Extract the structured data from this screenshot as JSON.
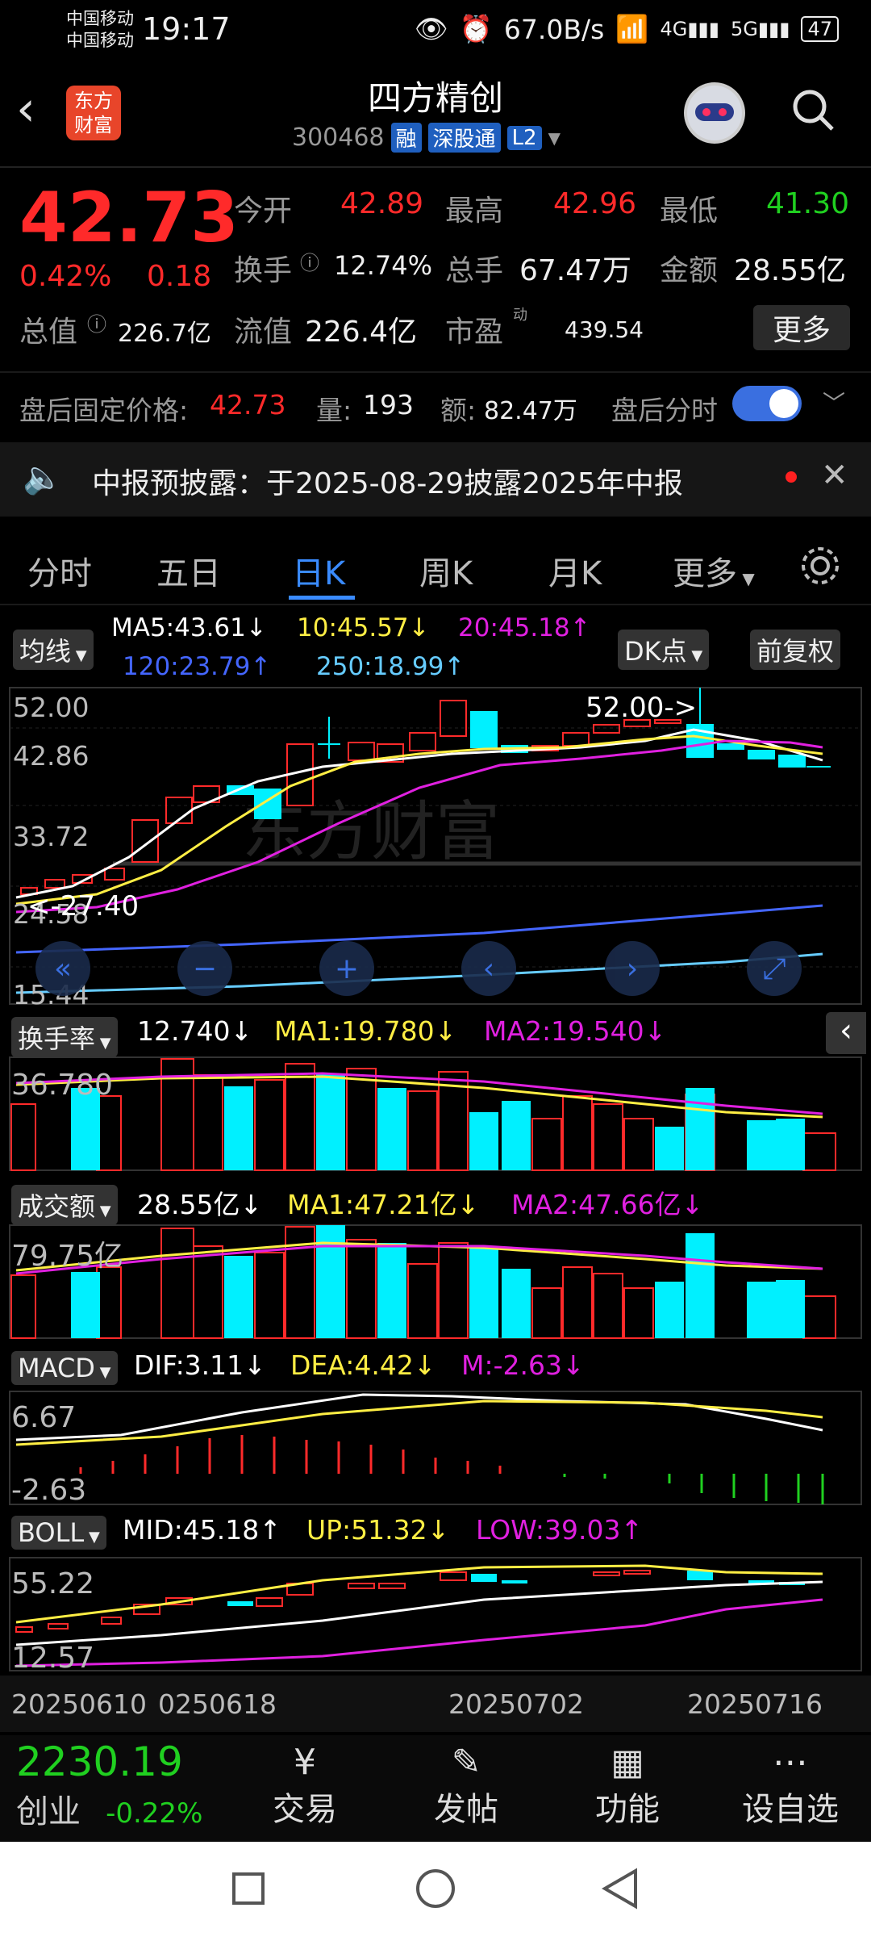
{
  "status": {
    "carrier1": "中国移动",
    "carrier2": "中国移动",
    "time": "19:17",
    "speed": "67.0B/s",
    "battery": "47"
  },
  "header": {
    "logo_line1": "东方",
    "logo_line2": "财富",
    "title": "四方精创",
    "code": "300468",
    "tag1": "融",
    "tag2": "深股通",
    "tag3": "L2"
  },
  "quote": {
    "price": "42.73",
    "pct": "0.42%",
    "change": "0.18",
    "open_label": "今开",
    "open": "42.89",
    "high_label": "最高",
    "high": "42.96",
    "low_label": "最低",
    "low": "41.30",
    "turnover_label": "换手",
    "turnover": "12.74%",
    "vol_label": "总手",
    "vol": "67.47万",
    "amount_label": "金额",
    "amount": "28.55亿",
    "mcap_label": "总值",
    "mcap": "226.7亿",
    "float_label": "流值",
    "float": "226.4亿",
    "pe_label": "市盈",
    "pe_sup": "动",
    "pe": "439.54",
    "more": "更多"
  },
  "afterhours": {
    "label": "盘后固定价格:",
    "price": "42.73",
    "vol_label": "量:",
    "vol": "193",
    "amt_label": "额:",
    "amt": "82.47万",
    "toggle_label": "盘后分时"
  },
  "notice": {
    "text": "中报预披露：于2025-08-29披露2025年中报"
  },
  "tabs": [
    "分时",
    "五日",
    "日K",
    "周K",
    "月K",
    "更多"
  ],
  "ma": {
    "btn": "均线",
    "ma5": "MA5:43.61↓",
    "ma10": "10:45.57↓",
    "ma20": "20:45.18↑",
    "ma120": "120:23.79↑",
    "ma250": "250:18.99↑",
    "dk": "DK点",
    "fq": "前复权"
  },
  "kline_axis": [
    "52.00",
    "42.86",
    "33.72",
    "24.58",
    "15.44"
  ],
  "kline_notes": {
    "high": "52.00->",
    "low": "<-27.40"
  },
  "watermark": "东方财富",
  "turnover_ind": {
    "btn": "换手率",
    "val": "12.740↓",
    "ma1": "MA1:19.780↓",
    "ma2": "MA2:19.540↓",
    "axis": "36.780"
  },
  "amount_ind": {
    "btn": "成交额",
    "val": "28.55亿↓",
    "ma1": "MA1:47.21亿↓",
    "ma2": "MA2:47.66亿↓",
    "axis": "79.75亿"
  },
  "macd_ind": {
    "btn": "MACD",
    "dif": "DIF:3.11↓",
    "dea": "DEA:4.42↓",
    "m": "M:-2.63↓",
    "top": "6.67",
    "bottom": "-2.63"
  },
  "boll_ind": {
    "btn": "BOLL",
    "mid": "MID:45.18↑",
    "up": "UP:51.32↓",
    "low": "LOW:39.03↑",
    "top": "55.22",
    "bottom": "12.57"
  },
  "dates": [
    "20250610",
    "0250618",
    "20250702",
    "20250716"
  ],
  "bottom": {
    "index": "2230.19",
    "index_name": "创业",
    "index_pct": "-0.22%",
    "trade": "交易",
    "post": "发帖",
    "func": "功能",
    "watch": "设自选"
  },
  "colors": {
    "up": "#ff2a2a",
    "down": "#00f0ff",
    "ma5": "#ffffff",
    "ma10": "#ffee44",
    "ma20": "#e020e0",
    "ma120": "#4466ff",
    "ma250": "#66ccff",
    "accent": "#3a8bff"
  }
}
